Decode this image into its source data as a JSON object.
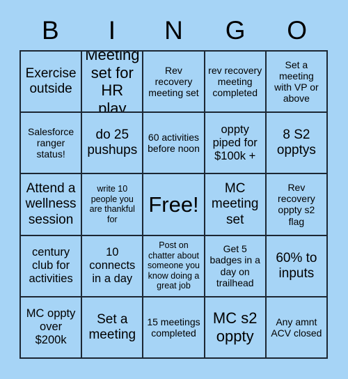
{
  "card": {
    "background_color": "#a6d4f6",
    "border_color": "#1c2733",
    "text_color": "#000000",
    "header_letters": [
      "B",
      "I",
      "N",
      "G",
      "O"
    ],
    "rows": [
      [
        {
          "text": "Exercise outside",
          "size": "fs-l"
        },
        {
          "text": "Meeting set for HR play",
          "size": "fs-xl"
        },
        {
          "text": "Rev recovery meeting set",
          "size": "fs-s"
        },
        {
          "text": "rev recovery meeting completed",
          "size": "fs-s"
        },
        {
          "text": "Set a meeting with VP or above",
          "size": "fs-s"
        }
      ],
      [
        {
          "text": "Salesforce ranger status!",
          "size": "fs-s"
        },
        {
          "text": "do 25 pushups",
          "size": "fs-l"
        },
        {
          "text": "60 activities before noon",
          "size": "fs-s"
        },
        {
          "text": "oppty piped for $100k +",
          "size": "fs-m"
        },
        {
          "text": "8 S2 opptys",
          "size": "fs-l"
        }
      ],
      [
        {
          "text": "Attend a wellness session",
          "size": "fs-l"
        },
        {
          "text": "write 10 people you are thankful for",
          "size": "fs-xs"
        },
        {
          "text": "Free!",
          "size": "fs-free"
        },
        {
          "text": "MC meeting set",
          "size": "fs-l"
        },
        {
          "text": "Rev recovery oppty s2 flag",
          "size": "fs-s"
        }
      ],
      [
        {
          "text": "century club for activities",
          "size": "fs-m"
        },
        {
          "text": "10 connects in a day",
          "size": "fs-m"
        },
        {
          "text": "Post on chatter about someone you know doing a great job",
          "size": "fs-xs"
        },
        {
          "text": "Get 5 badges in a day on trailhead",
          "size": "fs-s"
        },
        {
          "text": "60% to inputs",
          "size": "fs-l"
        }
      ],
      [
        {
          "text": "MC oppty over $200k",
          "size": "fs-m"
        },
        {
          "text": "Set a meeting",
          "size": "fs-l"
        },
        {
          "text": "15 meetings completed",
          "size": "fs-s"
        },
        {
          "text": "MC s2 oppty",
          "size": "fs-xl"
        },
        {
          "text": "Any amnt ACV closed",
          "size": "fs-s"
        }
      ]
    ]
  }
}
